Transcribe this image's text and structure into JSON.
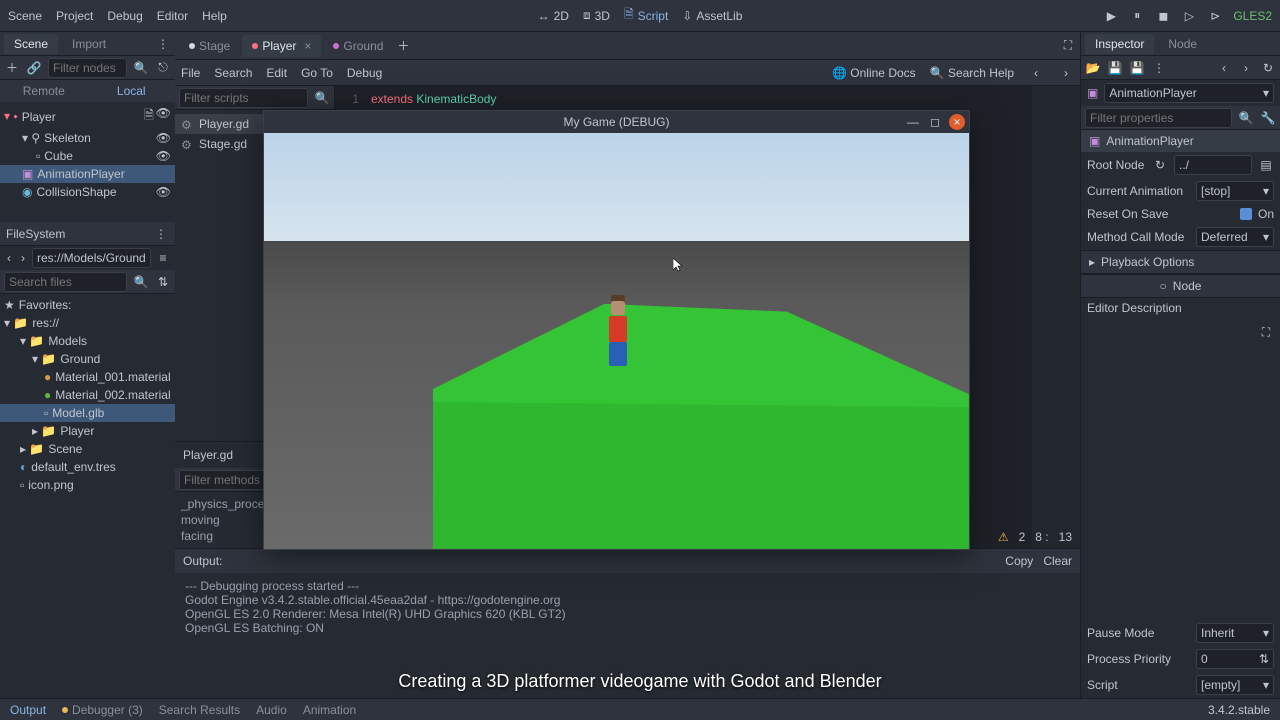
{
  "topmenu": {
    "scene": "Scene",
    "project": "Project",
    "debug": "Debug",
    "editor": "Editor",
    "help": "Help"
  },
  "modes": {
    "d2": "2D",
    "d3": "3D",
    "script": "Script",
    "assetlib": "AssetLib"
  },
  "top_right": {
    "renderer": "GLES2"
  },
  "scene_panel": {
    "tab_scene": "Scene",
    "tab_import": "Import",
    "filter_placeholder": "Filter nodes",
    "toggle_remote": "Remote",
    "toggle_local": "Local",
    "nodes": {
      "player": "Player",
      "skeleton": "Skeleton",
      "cube": "Cube",
      "anim": "AnimationPlayer",
      "collision": "CollisionShape"
    }
  },
  "filesystem": {
    "title": "FileSystem",
    "path": "res://Models/Ground/",
    "search_placeholder": "Search files",
    "favorites": "Favorites:",
    "res": "res://",
    "models": "Models",
    "ground": "Ground",
    "mat1": "Material_001.material",
    "mat2": "Material_002.material",
    "modelglb": "Model.glb",
    "playerf": "Player",
    "scenef": "Scene",
    "defenv": "default_env.tres",
    "iconpng": "icon.png"
  },
  "scene_tabs": {
    "stage": "Stage",
    "player": "Player",
    "ground": "Ground"
  },
  "script_menu": {
    "file": "File",
    "search": "Search",
    "edit": "Edit",
    "goto": "Go To",
    "debug": "Debug",
    "online_docs": "Online Docs",
    "search_help": "Search Help"
  },
  "script_side": {
    "filter_placeholder": "Filter scripts",
    "player_gd": "Player.gd",
    "stage_gd": "Stage.gd",
    "current": "Player.gd",
    "filter_methods_placeholder": "Filter methods",
    "m1": "_physics_process",
    "m2": "moving",
    "m3": "facing"
  },
  "code": {
    "line1_no": "1",
    "extends": "extends",
    "klass": "KinematicBody"
  },
  "game_window": {
    "title": "My Game (DEBUG)"
  },
  "output": {
    "label": "Output:",
    "copy": "Copy",
    "clear": "Clear",
    "l1": "--- Debugging process started ---",
    "l2": "Godot Engine v3.4.2.stable.official.45eaa2daf - https://godotengine.org",
    "l3": "OpenGL ES 2.0 Renderer: Mesa Intel(R) UHD Graphics 620 (KBL GT2)",
    "l4": "OpenGL ES Batching: ON"
  },
  "warn_err": {
    "warn": "2",
    "err_pre": "8 :",
    "err": "13"
  },
  "bottom": {
    "output": "Output",
    "debugger": "Debugger (3)",
    "search_results": "Search Results",
    "audio": "Audio",
    "animation": "Animation",
    "version": "3.4.2.stable"
  },
  "inspector": {
    "tab_inspector": "Inspector",
    "tab_node": "Node",
    "node_type": "AnimationPlayer",
    "filter_placeholder": "Filter properties",
    "bread": "AnimationPlayer",
    "root_node": "Root Node",
    "cur_anim": "Current Animation",
    "cur_anim_val": "[stop]",
    "reset_on_save": "Reset On Save",
    "on": "On",
    "method_mode": "Method Call Mode",
    "method_mode_val": "Deferred",
    "playback": "Playback Options",
    "node_sub": "Node",
    "editor_desc": "Editor Description",
    "pause_mode": "Pause Mode",
    "pause_mode_val": "Inherit",
    "process_priority": "Process Priority",
    "process_priority_val": "0",
    "script": "Script",
    "script_val": "[empty]"
  },
  "caption": "Creating a 3D platformer videogame with Godot and Blender"
}
